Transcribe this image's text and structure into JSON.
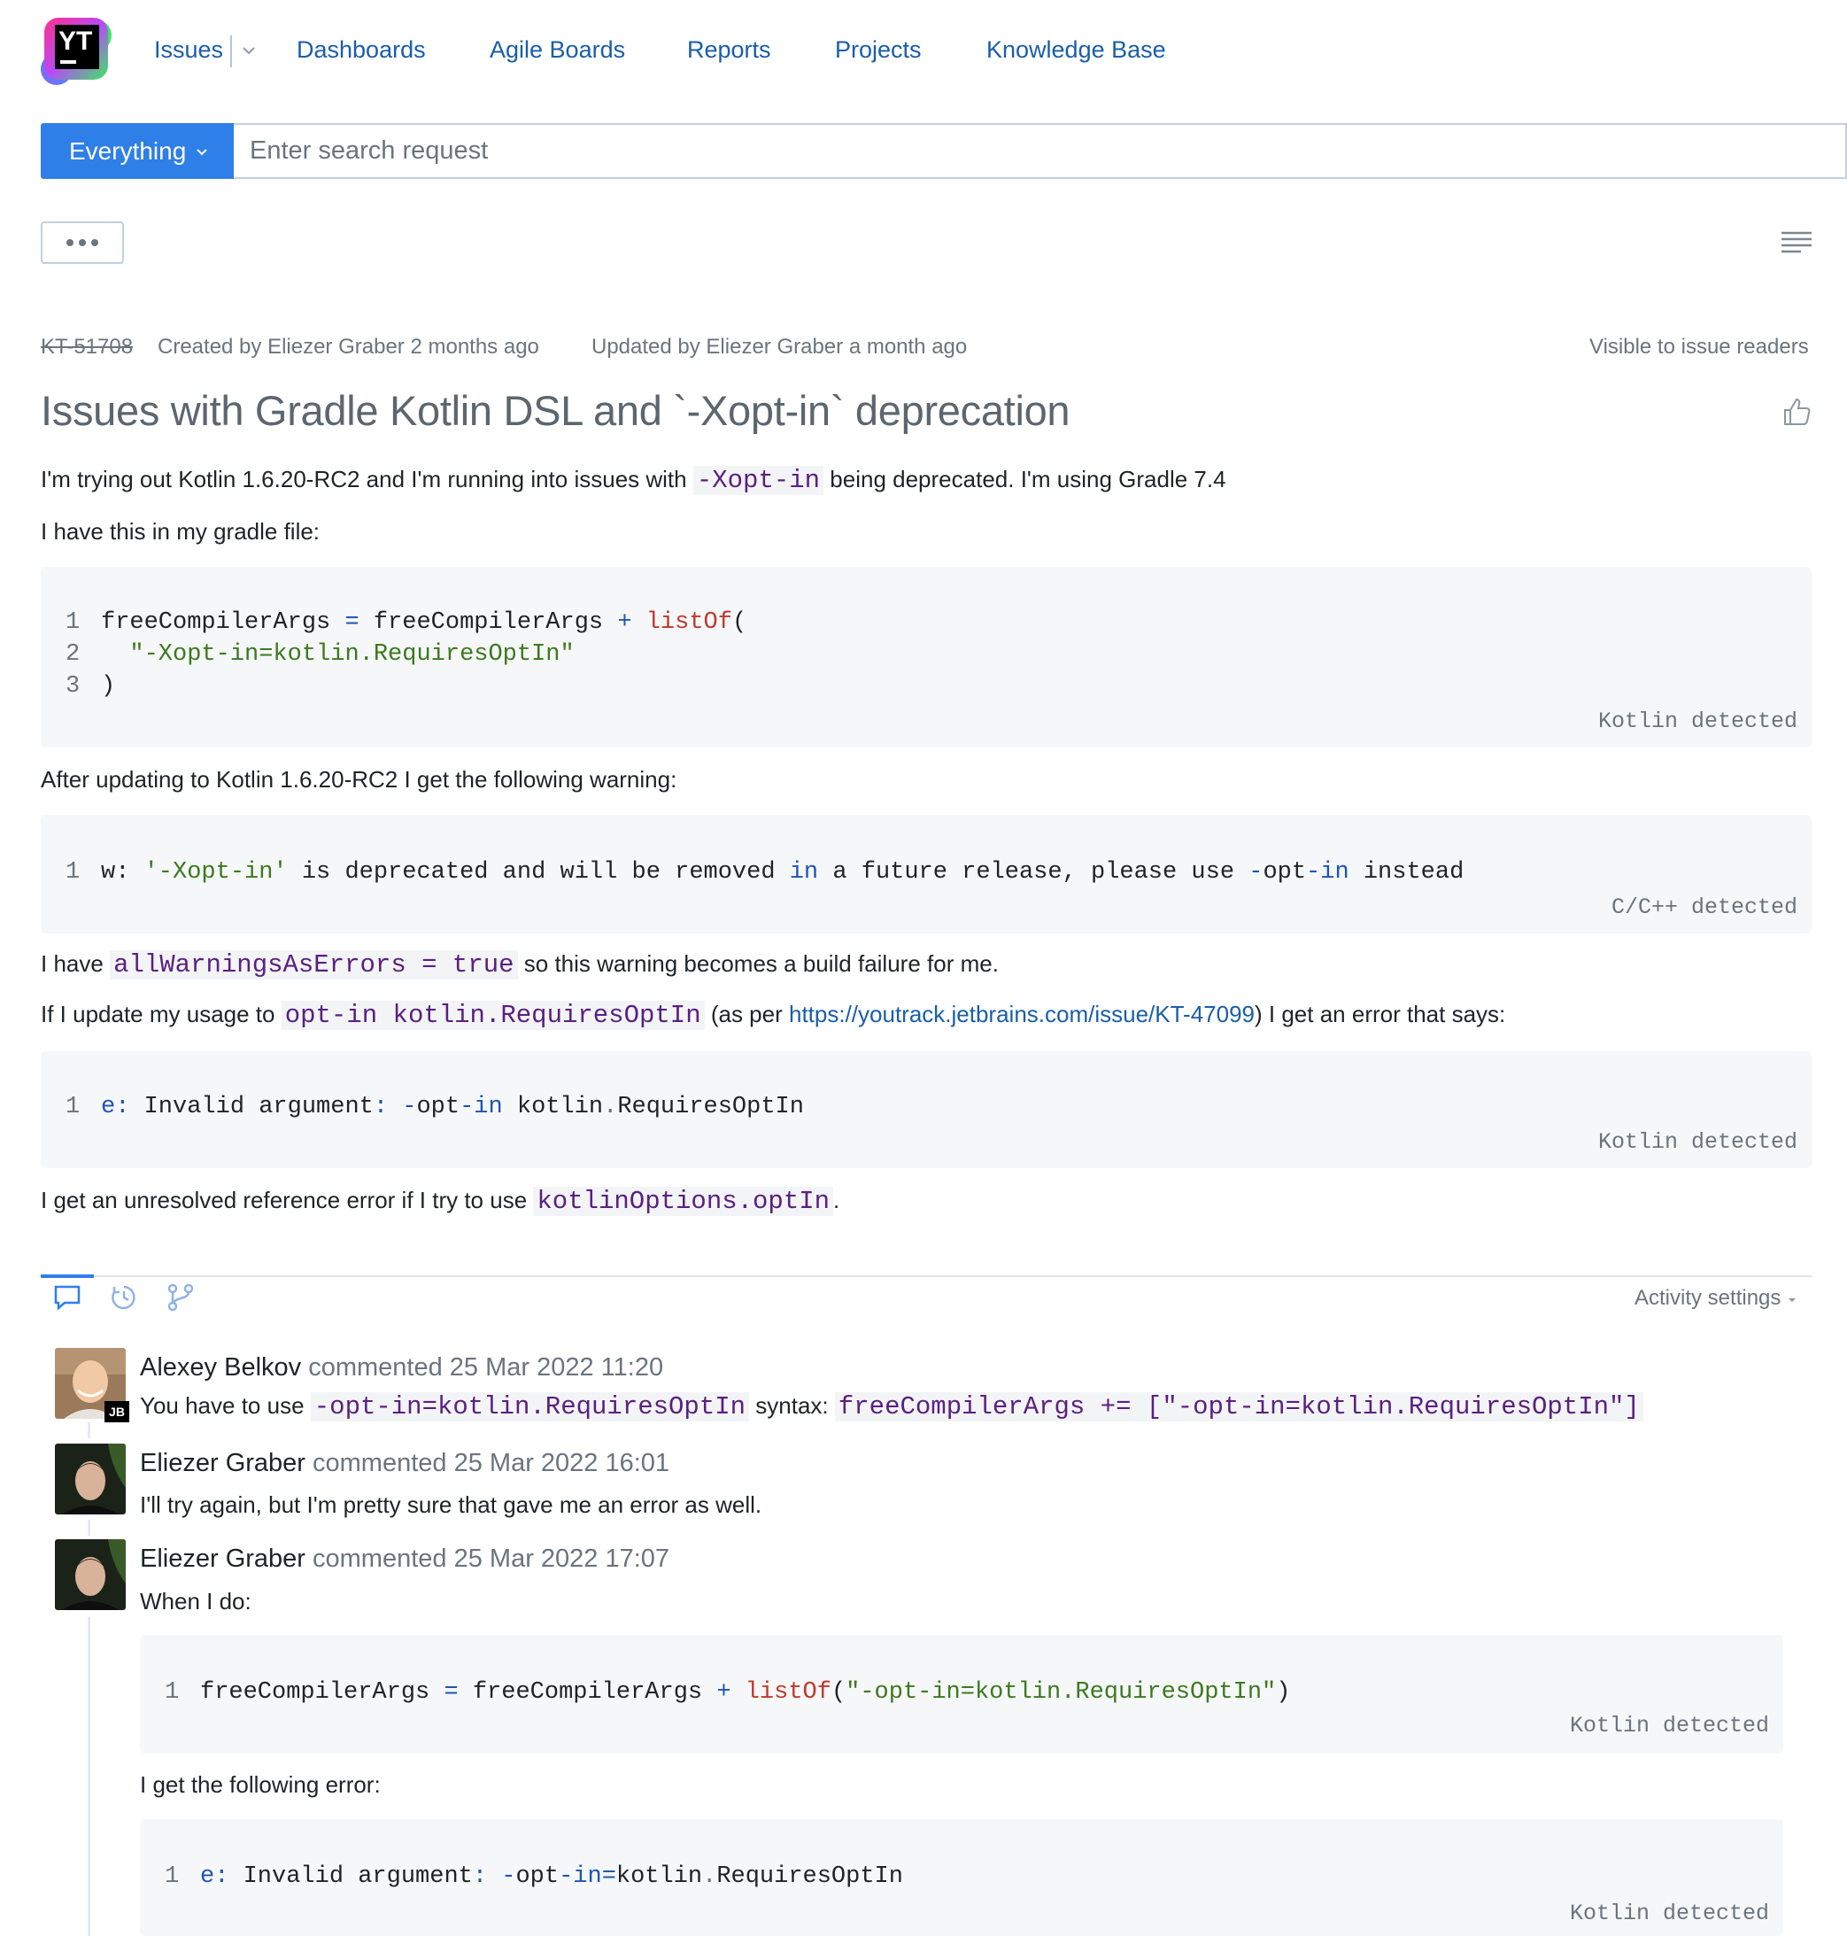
{
  "app": {
    "logo_text": "YT"
  },
  "nav": {
    "items": [
      "Issues",
      "Dashboards",
      "Agile Boards",
      "Reports",
      "Projects",
      "Knowledge Base"
    ]
  },
  "search": {
    "scope_label": "Everything",
    "placeholder": "Enter search request"
  },
  "issue": {
    "id": "KT-51708",
    "created": "Created by Eliezer Graber 2 months ago",
    "updated": "Updated by Eliezer Graber a month ago",
    "visibility": "Visible to issue readers",
    "title": "Issues with Gradle Kotlin DSL and `-Xopt-in` deprecation",
    "p1_a": "I'm trying out Kotlin 1.6.20-RC2 and I'm running into issues with ",
    "p1_code": "-Xopt-in",
    "p1_b": " being deprecated. I'm using Gradle 7.4",
    "p2": "I have this in my gradle file:",
    "code1_detected": "Kotlin detected",
    "p3": "After updating to Kotlin 1.6.20-RC2 I get the following warning:",
    "code2_detected": "C/C++ detected",
    "p4_a": "I have ",
    "p4_code": "allWarningsAsErrors = true",
    "p4_b": " so this warning becomes a build failure for me.",
    "p5_a": "If I update my usage to ",
    "p5_code": "opt-in kotlin.RequiresOptIn",
    "p5_b": " (as per ",
    "p5_link": "https://youtrack.jetbrains.com/issue/KT-47099",
    "p5_c": ") I get an error that says:",
    "code3_detected": "Kotlin detected",
    "p6_a": "I get an unresolved reference error if I try to use ",
    "p6_code": "kotlinOptions.optIn",
    "p6_b": "."
  },
  "activity": {
    "settings_label": "Activity settings"
  },
  "comments": [
    {
      "author": "Alexey Belkov",
      "meta": " commented 25 Mar 2022 11:20",
      "body_a": "You have to use ",
      "body_code1": "-opt-in=kotlin.RequiresOptIn",
      "body_b": " syntax: ",
      "body_code2": "freeCompilerArgs += [\"-opt-in=kotlin.RequiresOptIn\"]",
      "badge": "JB"
    },
    {
      "author": "Eliezer Graber",
      "meta": " commented 25 Mar 2022 16:01",
      "body": "I'll try again, but I'm pretty sure that gave me an error as well."
    },
    {
      "author": "Eliezer Graber",
      "meta": " commented 25 Mar 2022 17:07",
      "body1": "When I do:",
      "code_detected": "Kotlin detected",
      "body2": "I get the following error:",
      "code2_detected": "Kotlin detected"
    }
  ]
}
